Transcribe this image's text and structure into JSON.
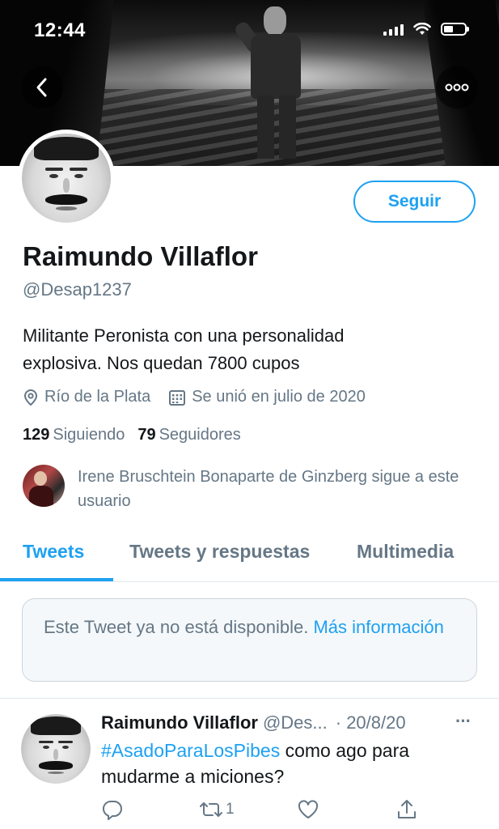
{
  "status_bar": {
    "time": "12:44"
  },
  "profile": {
    "display_name": "Raimundo Villaflor",
    "handle": "@Desap1237",
    "follow_label": "Seguir",
    "bio_line1": "Militante Peronista con una personalidad",
    "bio_line2": "explosiva. Nos quedan 7800 cupos",
    "location": "Río de la Plata",
    "joined": "Se unió en julio de 2020",
    "following_count": "129",
    "following_label": "Siguiendo",
    "followers_count": "79",
    "followers_label": "Seguidores",
    "followed_by": "Irene Bruschtein Bonaparte de Ginzberg sigue a este usuario"
  },
  "tabs": [
    {
      "label": "Tweets",
      "active": true
    },
    {
      "label": "Tweets y respuestas",
      "active": false
    },
    {
      "label": "Multimedia",
      "active": false
    }
  ],
  "unavailable": {
    "text": "Este Tweet ya no está disponible. ",
    "link": "Más información"
  },
  "tweet": {
    "name": "Raimundo Villaflor",
    "user": "@Des...",
    "date": "· 20/8/20",
    "more": "···",
    "hashtag": "#AsadoParaLosPibes",
    "text": " como ago para mudarme a miciones?",
    "retweet_count": "1"
  },
  "icons": {
    "back": "chevron-left-icon",
    "more": "ellipsis-icon",
    "location": "location-pin-icon",
    "calendar": "calendar-icon",
    "reply": "reply-icon",
    "retweet": "retweet-icon",
    "like": "heart-icon",
    "share": "share-icon"
  },
  "colors": {
    "accent": "#1da1f2",
    "muted": "#657786",
    "text": "#14171a",
    "border": "#e1e8ed"
  }
}
